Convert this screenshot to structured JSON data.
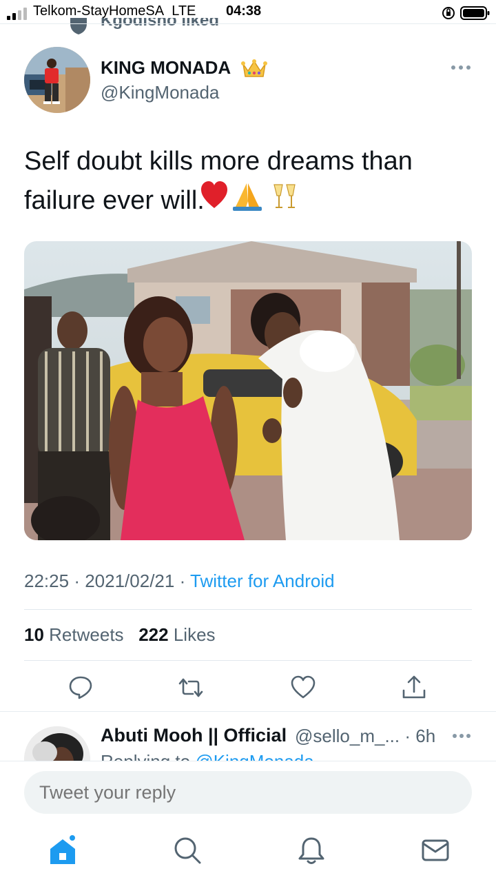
{
  "status_bar": {
    "carrier": "Telkom-StayHomeSA",
    "network": "LTE",
    "time": "04:38"
  },
  "social_context": {
    "text": "Kgodisho liked",
    "icon": "heart-shield-icon"
  },
  "tweet": {
    "author_name": "KING MONADA",
    "author_badge_emoji": "👑",
    "author_handle": "@KingMonada",
    "text": "Self doubt kills more dreams than failure ever will.",
    "emojis": [
      "❤️",
      "🙏",
      "🥂"
    ],
    "time": "22:25",
    "date": "2021/02/21",
    "separator": "·",
    "source": "Twitter for Android",
    "retweets_count": "10",
    "retweets_label": "Retweets",
    "likes_count": "222",
    "likes_label": "Likes"
  },
  "actions": [
    {
      "name": "reply-icon"
    },
    {
      "name": "retweet-icon"
    },
    {
      "name": "like-icon"
    },
    {
      "name": "share-icon"
    }
  ],
  "reply_preview": {
    "name": "Abuti Mooh || Official",
    "handle": "@sello_m_...",
    "time": "· 6h",
    "replying_prefix": "Replying to ",
    "replying_mention": "@KingMonada"
  },
  "compose": {
    "placeholder": "Tweet your reply"
  },
  "bottom_nav": [
    {
      "name": "home-icon",
      "active": true
    },
    {
      "name": "search-icon",
      "active": false
    },
    {
      "name": "notifications-icon",
      "active": false
    },
    {
      "name": "messages-icon",
      "active": false
    }
  ],
  "colors": {
    "accent": "#1d9bf0",
    "text_primary": "#0f1419",
    "text_secondary": "#536471",
    "divider": "#e6ecf0"
  }
}
